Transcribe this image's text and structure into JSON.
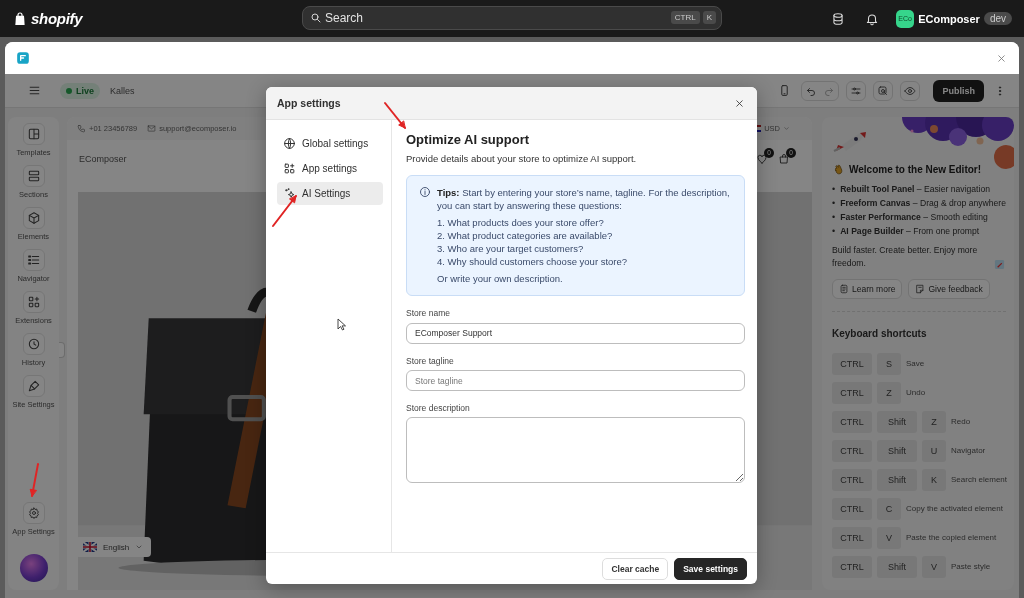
{
  "topbar": {
    "brand": "shopify",
    "search": {
      "placeholder": "Search"
    },
    "shortcut": [
      "CTRL",
      "K"
    ],
    "avatar": "ECo",
    "store_name": "EComposer",
    "badge": "dev"
  },
  "editor_toolbar": {
    "status": "Live",
    "store": "Kalles",
    "publish": "Publish"
  },
  "left_rail": {
    "items": [
      {
        "label": "Templates"
      },
      {
        "label": "Sections"
      },
      {
        "label": "Elements"
      },
      {
        "label": "Navigator"
      },
      {
        "label": "Extensions"
      },
      {
        "label": "History"
      },
      {
        "label": "Site Settings"
      }
    ],
    "footer": {
      "label": "App Settings"
    }
  },
  "canvas": {
    "phone": "+01 23456789",
    "email": "support@ecomposer.io",
    "currency": "USD",
    "site_title": "EComposer",
    "cart_badges": [
      "0",
      "0"
    ],
    "language": "English"
  },
  "welcome": {
    "title": "Welcome to the New Editor!",
    "features": [
      {
        "marker": "•",
        "text": "**Rebuilt Tool Panel** – Easier navigation"
      },
      {
        "marker": "•",
        "text": "**Freeform Canvas** – Drag & drop anywhere"
      },
      {
        "marker": "•",
        "text": "**Faster Performance** – Smooth editing"
      },
      {
        "marker": "•",
        "text": "**AI Page Builder** – From one prompt"
      }
    ],
    "tagline": "Build faster. Create better. Enjoy more freedom.",
    "buttons": [
      "Learn more",
      "Give feedback"
    ]
  },
  "shortcuts": {
    "title": "Keyboard shortcuts",
    "items": [
      {
        "keys": [
          "CTRL",
          "S"
        ],
        "action": "Save"
      },
      {
        "keys": [
          "CTRL",
          "Z"
        ],
        "action": "Undo"
      },
      {
        "keys": [
          "CTRL",
          "Shift",
          "Z"
        ],
        "action": "Redo"
      },
      {
        "keys": [
          "CTRL",
          "Shift",
          "U"
        ],
        "action": "Navigator"
      },
      {
        "keys": [
          "CTRL",
          "Shift",
          "K"
        ],
        "action": "Search element"
      },
      {
        "keys": [
          "CTRL",
          "C"
        ],
        "action": "Copy the activated element"
      },
      {
        "keys": [
          "CTRL",
          "V"
        ],
        "action": "Paste the copied element"
      },
      {
        "keys": [
          "CTRL",
          "Shift",
          "V"
        ],
        "action": "Paste style"
      }
    ]
  },
  "modal": {
    "title": "App settings",
    "nav": [
      {
        "label": "Global settings",
        "selected": false
      },
      {
        "label": "App settings",
        "selected": false
      },
      {
        "label": "AI Settings",
        "selected": true
      }
    ],
    "heading": "Optimize AI support",
    "subtitle": "Provide details about your store to optimize AI support.",
    "tips": {
      "text": "**Tips:** Start by entering your store’s name, tagline. For the description, you can start by answering these questions:",
      "questions": [
        "1. What products does your store offer?",
        "2. What product categories are available?",
        "3. Who are your target customers?",
        "4. Why should customers choose your store?"
      ],
      "closing": "Or write your own description."
    },
    "fields": [
      {
        "kind": "input",
        "label": "Store name",
        "value": "EComposer Support"
      },
      {
        "kind": "input",
        "label": "Store tagline",
        "placeholder": "Store tagline"
      },
      {
        "kind": "textarea",
        "label": "Store description"
      }
    ],
    "buttons": [
      {
        "kind": "secondary",
        "label": "Clear cache"
      },
      {
        "kind": "primary",
        "label": "Save settings"
      }
    ]
  }
}
